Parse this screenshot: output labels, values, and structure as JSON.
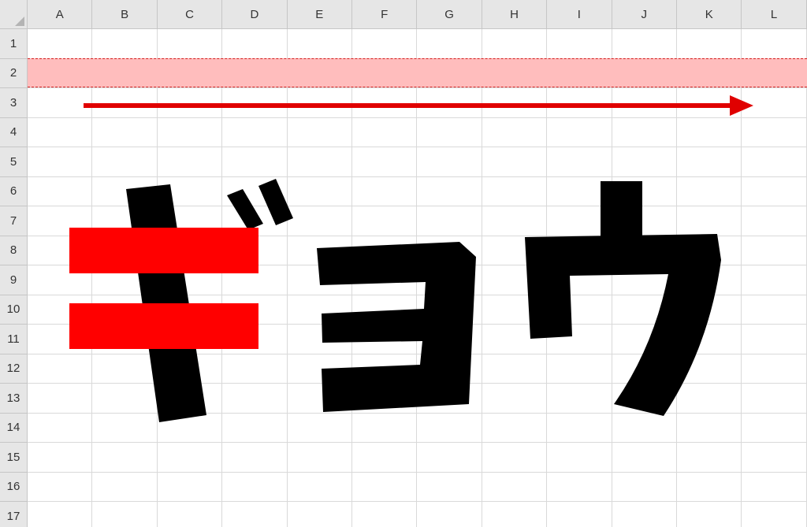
{
  "columns": [
    "A",
    "B",
    "C",
    "D",
    "E",
    "F",
    "G",
    "H",
    "I",
    "J",
    "K",
    "L"
  ],
  "rows": [
    "1",
    "2",
    "3",
    "4",
    "5",
    "6",
    "7",
    "8",
    "9",
    "10",
    "11",
    "12",
    "13",
    "14",
    "15",
    "16",
    "17"
  ],
  "highlighted_row": "2",
  "colors": {
    "highlight_fill": "#ffbdbd",
    "highlight_dash": "#d42020",
    "arrow": "#e00000",
    "katakana_stroke": "#000000",
    "red_bars": "#ff0000"
  }
}
